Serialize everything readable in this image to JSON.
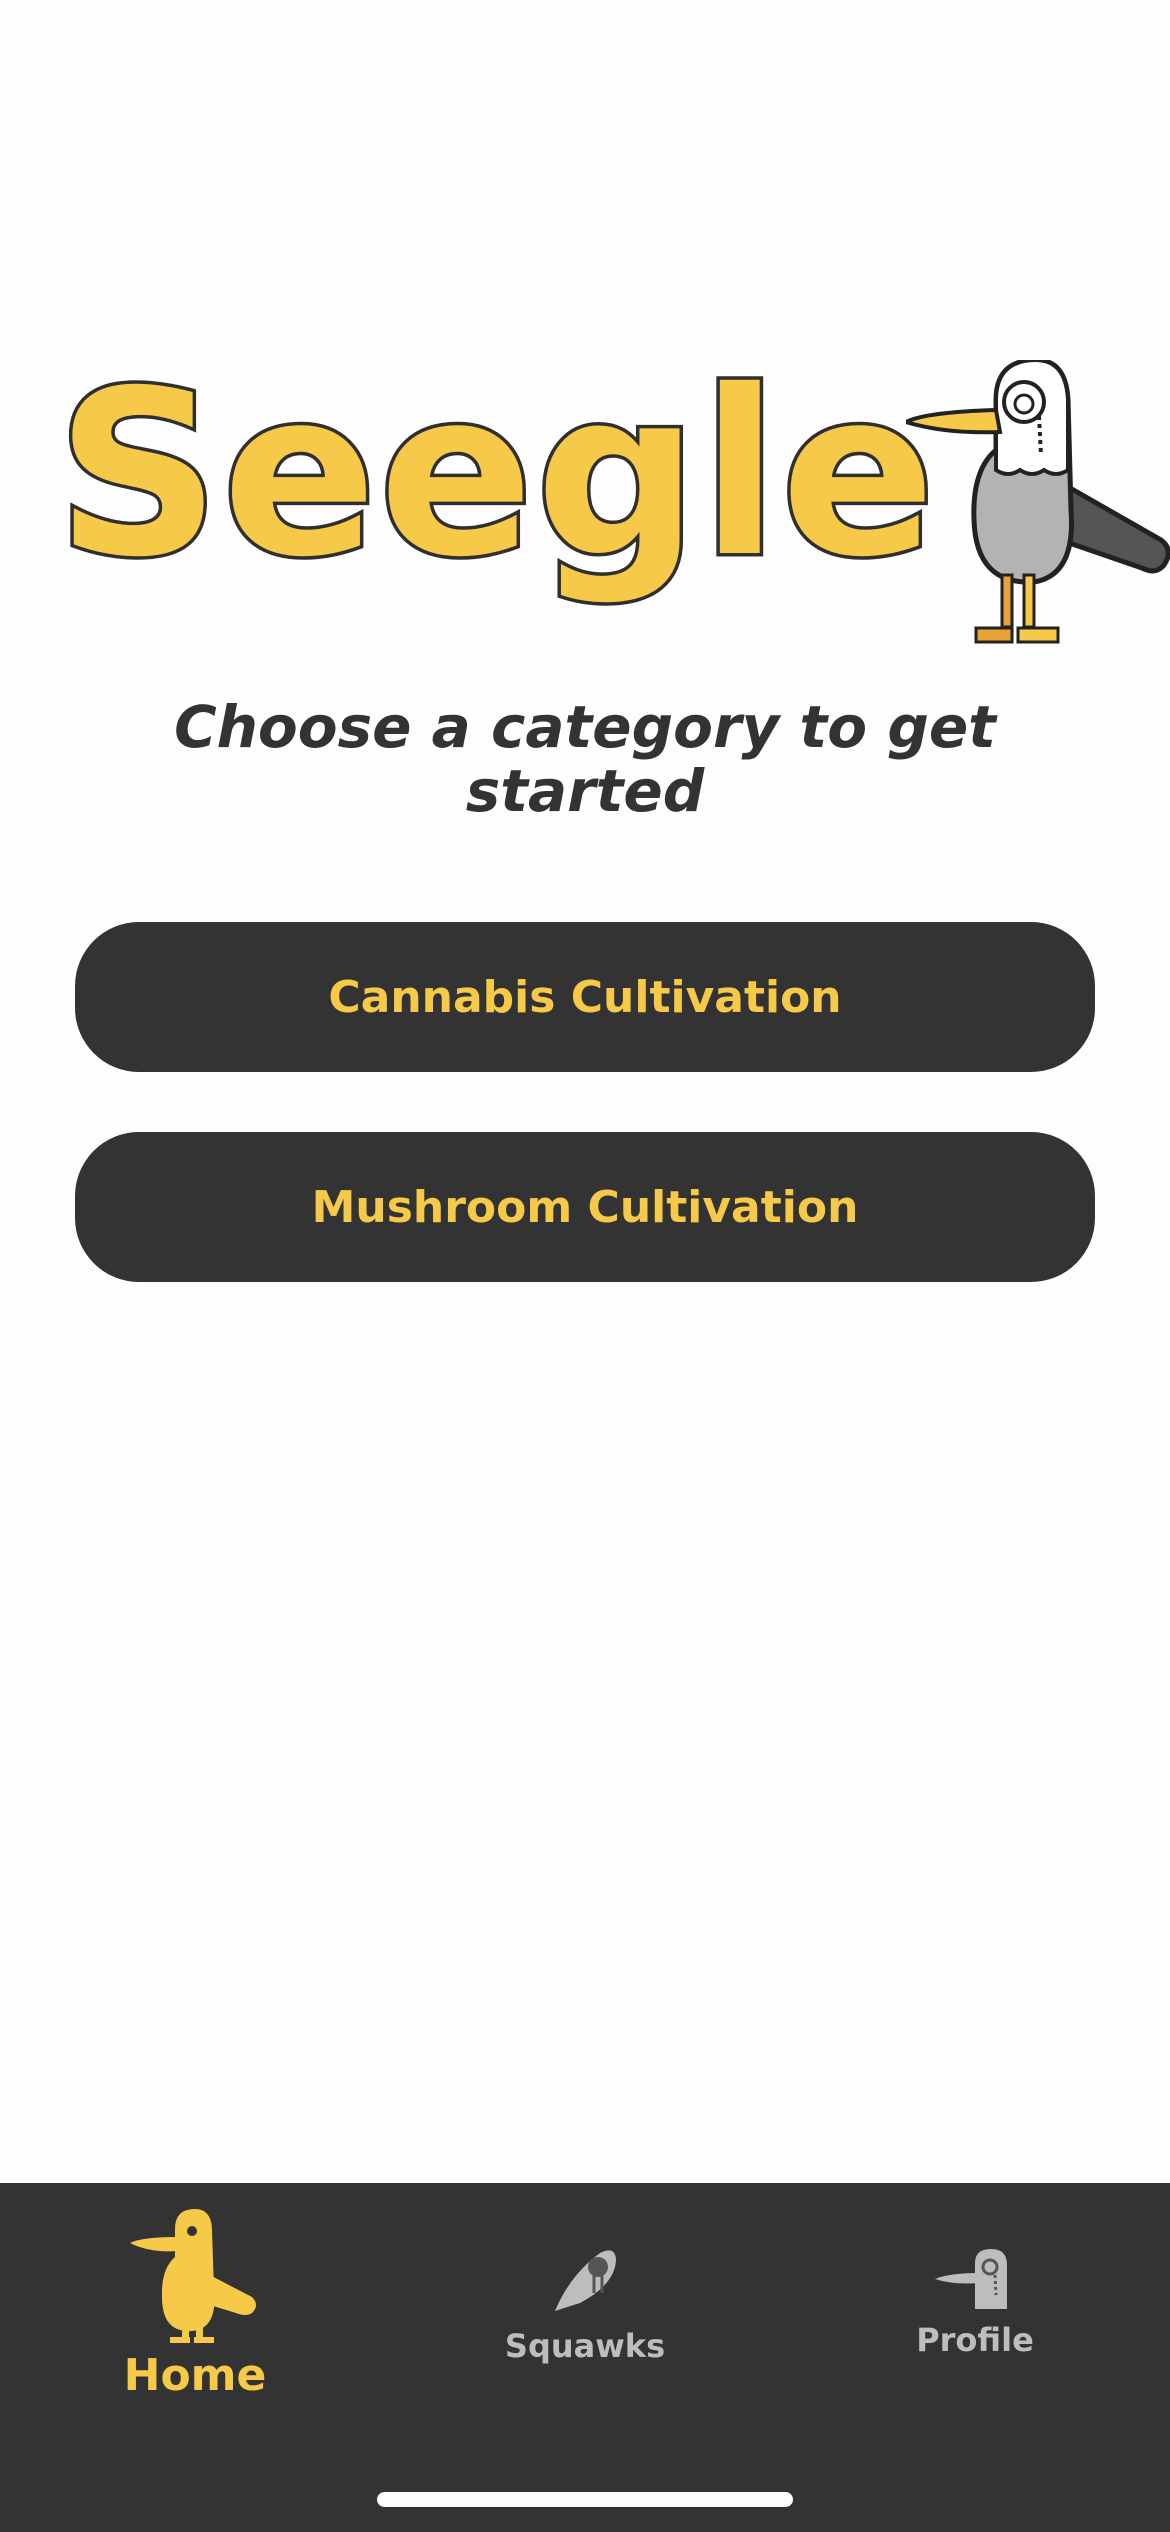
{
  "app": {
    "logo_text": "Seegle",
    "tagline": "Choose a category to get started"
  },
  "categories": [
    {
      "label": "Cannabis Cultivation"
    },
    {
      "label": "Mushroom Cultivation"
    }
  ],
  "tabbar": {
    "tabs": [
      {
        "label": "Home",
        "icon": "seagull-icon",
        "active": true
      },
      {
        "label": "Squawks",
        "icon": "seagull-feather-icon",
        "active": false
      },
      {
        "label": "Profile",
        "icon": "seagull-head-icon",
        "active": false
      }
    ]
  },
  "colors": {
    "accent": "#f7c948",
    "dark": "#333333",
    "background": "#fdfdfd",
    "inactive_tab": "#bdbdbd"
  }
}
